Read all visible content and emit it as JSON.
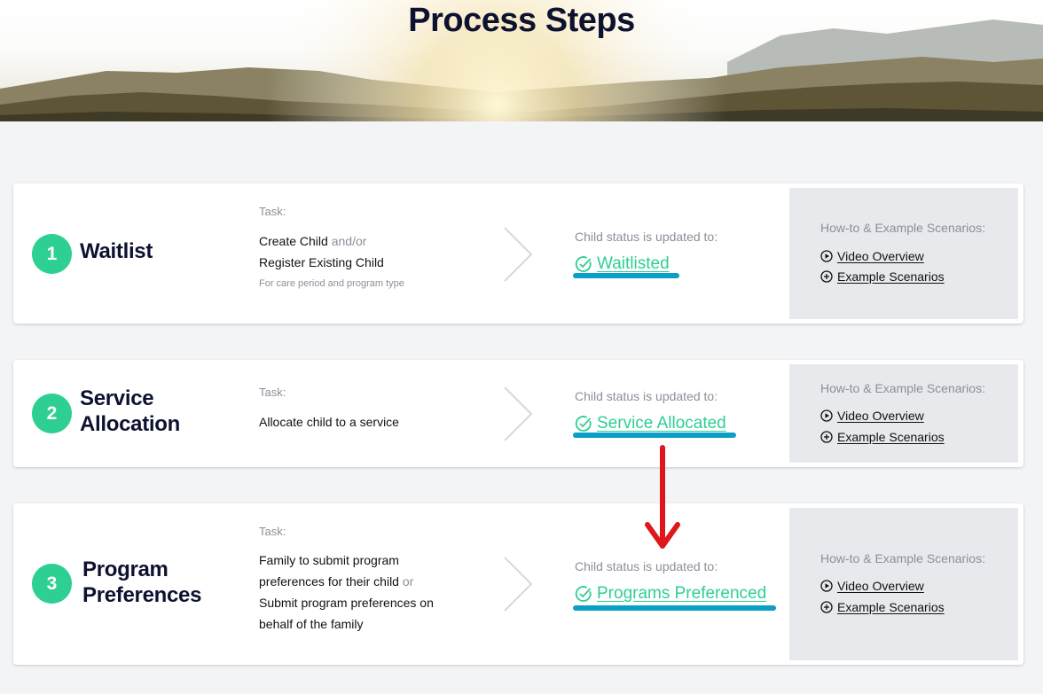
{
  "header": {
    "title": "Process Steps"
  },
  "steps": [
    {
      "number": "1",
      "title": "Waitlist",
      "task_label": "Task:",
      "task_strong_1": "Create Child",
      "task_muted_1": " and/or",
      "task_strong_2": "Register Existing Child",
      "task_note": "For care period and program type",
      "status_label": "Child status is updated to:",
      "status": "Waitlisted",
      "side_label": "How-to & Example Scenarios:",
      "video_link": "Video Overview",
      "example_link": "Example Scenarios"
    },
    {
      "number": "2",
      "title_line1": "Service",
      "title_line2": "Allocation",
      "task_label": "Task:",
      "task_text": "Allocate child to a service",
      "status_label": "Child status is updated to:",
      "status": "Service Allocated",
      "side_label": "How-to & Example Scenarios:",
      "video_link": "Video Overview",
      "example_link": "Example Scenarios"
    },
    {
      "number": "3",
      "title_line1": "Program",
      "title_line2": "Preferences",
      "task_label": "Task:",
      "task_part1": "Family to submit program preferences for their child",
      "task_muted": " or ",
      "task_part2": "Submit program preferences on behalf of the family",
      "status_label": "Child status is updated to:",
      "status": "Programs Preferenced",
      "side_label": "How-to & Example Scenarios:",
      "video_link": "Video Overview",
      "example_link": "Example Scenarios"
    }
  ],
  "colors": {
    "accent_green": "#2ecf93",
    "annotation_blue": "#0aa0c6",
    "annotation_red": "#e0161d",
    "title_navy": "#0d1230",
    "side_panel": "#e8e9ec"
  },
  "icons": {
    "status": "check-circle-icon",
    "video": "play-circle-icon",
    "example": "plus-circle-icon",
    "divider": "chevron-right-icon"
  }
}
